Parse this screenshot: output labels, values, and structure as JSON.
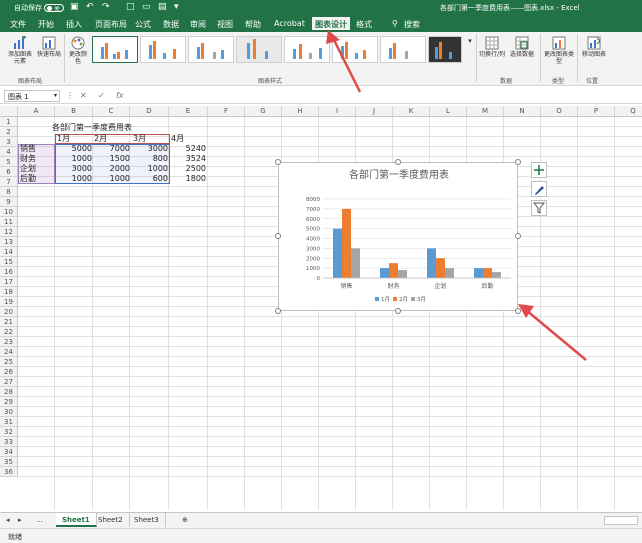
{
  "titlebar": {
    "autosave_label": "自动保存",
    "autosave_state": "关",
    "window_title": "各部门第一季度费用表——图表.xlsx - Excel"
  },
  "ribbon_tabs": [
    "文件",
    "开始",
    "插入",
    "页面布局",
    "公式",
    "数据",
    "审阅",
    "视图",
    "帮助",
    "Acrobat",
    "图表设计",
    "格式",
    "搜索"
  ],
  "active_tab": "图表设计",
  "ribbon": {
    "add_element": "添加图表元素",
    "quick_layout": "快速布局",
    "change_colors": "更改颜色",
    "group_layouts": "图表布局",
    "group_styles": "图表样式",
    "switch_rowcol": "切换行/列",
    "select_data": "选择数据",
    "group_data": "数据",
    "change_type": "更改图表类型",
    "group_type": "类型",
    "move_chart": "移动图表",
    "group_location": "位置"
  },
  "formula_bar": {
    "name_box": "图表 1",
    "fx": "fx",
    "formula": ""
  },
  "columns": [
    "A",
    "B",
    "C",
    "D",
    "E",
    "F",
    "G",
    "H",
    "I",
    "J",
    "K",
    "L",
    "M",
    "N",
    "O",
    "P",
    "Q"
  ],
  "rows": [
    "1",
    "2",
    "3",
    "4",
    "5",
    "6",
    "7",
    "8",
    "9",
    "10",
    "11",
    "12",
    "13",
    "14",
    "15",
    "16",
    "17",
    "18",
    "19",
    "20",
    "21",
    "22",
    "23",
    "24",
    "25",
    "26",
    "27",
    "28",
    "29",
    "30",
    "31",
    "32",
    "33",
    "34",
    "35",
    "36"
  ],
  "table": {
    "title": "各部门第一季度费用表",
    "headers": [
      "1月",
      "2月",
      "3月",
      "4月"
    ],
    "rows": [
      {
        "dept": "销售",
        "v": [
          "5000",
          "7000",
          "3000",
          "5240"
        ]
      },
      {
        "dept": "财务",
        "v": [
          "1000",
          "1500",
          "800",
          "3524"
        ]
      },
      {
        "dept": "企划",
        "v": [
          "3000",
          "2000",
          "1000",
          "2500"
        ]
      },
      {
        "dept": "后勤",
        "v": [
          "1000",
          "1000",
          "600",
          "1800"
        ]
      }
    ]
  },
  "chart_data": {
    "type": "bar",
    "title": "各部门第一季度费用表",
    "categories": [
      "销售",
      "财务",
      "企划",
      "后勤"
    ],
    "series": [
      {
        "name": "1月",
        "values": [
          5000,
          1000,
          3000,
          1000
        ],
        "color": "#5b9bd5"
      },
      {
        "name": "2月",
        "values": [
          7000,
          1500,
          2000,
          1000
        ],
        "color": "#ed7d31"
      },
      {
        "name": "3月",
        "values": [
          3000,
          800,
          1000,
          600
        ],
        "color": "#a5a5a5"
      }
    ],
    "yticks": [
      "0",
      "1000",
      "2000",
      "3000",
      "4000",
      "5000",
      "6000",
      "7000",
      "8000"
    ],
    "ylim": [
      0,
      8000
    ],
    "grid": true,
    "legend": "bottom"
  },
  "sheet_tabs": [
    "Sheet1",
    "Sheet2",
    "Sheet3"
  ],
  "active_sheet": "Sheet1",
  "status_text": "就绪",
  "colors": {
    "excel_green": "#217346",
    "arrow_red": "#e04a4a"
  }
}
